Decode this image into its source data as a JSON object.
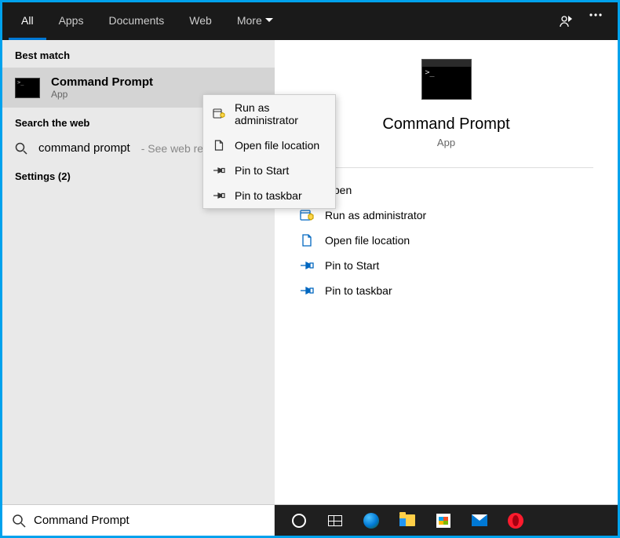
{
  "header": {
    "tabs": [
      "All",
      "Apps",
      "Documents",
      "Web",
      "More"
    ],
    "active_tab": 0
  },
  "left": {
    "best_match_label": "Best match",
    "best_match": {
      "title": "Command Prompt",
      "subtitle": "App"
    },
    "search_web_label": "Search the web",
    "web_query": "command prompt",
    "web_hint": "- See web results",
    "settings_label": "Settings (2)"
  },
  "context_menu": [
    "Run as administrator",
    "Open file location",
    "Pin to Start",
    "Pin to taskbar"
  ],
  "detail": {
    "title": "Command Prompt",
    "subtitle": "App",
    "actions": [
      "Open",
      "Run as administrator",
      "Open file location",
      "Pin to Start",
      "Pin to taskbar"
    ]
  },
  "search_value": "Command Prompt"
}
